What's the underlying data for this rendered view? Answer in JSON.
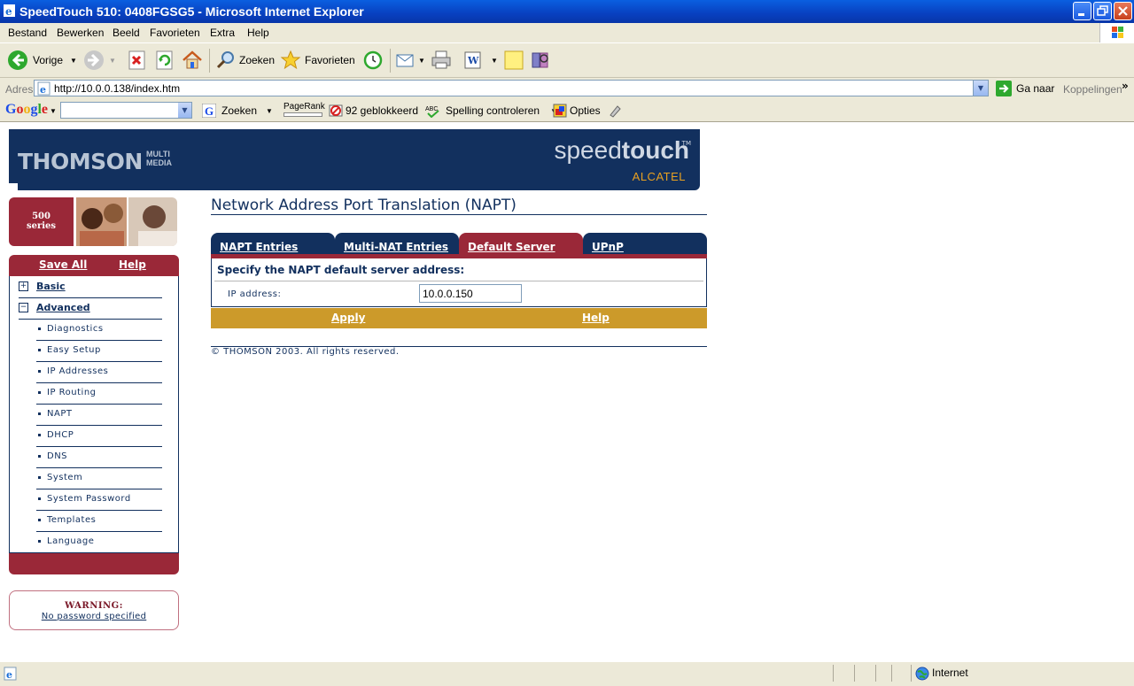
{
  "window": {
    "title": "SpeedTouch 510:  0408FGSG5 - Microsoft Internet Explorer"
  },
  "menu": [
    "Bestand",
    "Bewerken",
    "Beeld",
    "Favorieten",
    "Extra",
    "Help"
  ],
  "toolbar": {
    "back": "Vorige",
    "search": "Zoeken",
    "favorites": "Favorieten"
  },
  "address": {
    "label": "Adres",
    "url": "http://10.0.0.138/index.htm",
    "go": "Ga naar",
    "links": "Koppelingen"
  },
  "google_bar": {
    "logo": "Google",
    "search": "Zoeken",
    "pagerank": "PageRank",
    "blocked": "92 geblokkeerd",
    "spell": "Spelling controleren",
    "options": "Opties"
  },
  "banner": {
    "brand": "THOMSON",
    "brand_sub1": "MULTI",
    "brand_sub2": "MEDIA",
    "product_light": "speed",
    "product_bold": "touch",
    "tm": "TM",
    "maker": "ALCATEL"
  },
  "badge": {
    "line1": "500",
    "line2": "series"
  },
  "sidebar": {
    "save_all": "Save All",
    "help": "Help",
    "basic": "Basic",
    "advanced": "Advanced",
    "items": [
      "Diagnostics",
      "Easy Setup",
      "IP Addresses",
      "IP Routing",
      "NAPT",
      "DHCP",
      "DNS",
      "System",
      "System Password",
      "Templates",
      "Language"
    ]
  },
  "warning": {
    "title": "WARNING:",
    "link": "No password specified"
  },
  "content": {
    "title": "Network Address Port Translation (NAPT)",
    "tabs": [
      "NAPT Entries",
      "Multi-NAT Entries",
      "Default Server",
      "UPnP"
    ],
    "active_tab": "Default Server",
    "heading": "Specify the NAPT default server address:",
    "ip_label": "IP address:",
    "ip_value": "10.0.0.150",
    "apply": "Apply",
    "help": "Help",
    "copyright": "© THOMSON 2003. All rights reserved."
  },
  "status": {
    "zone": "Internet"
  },
  "colors": {
    "navy": "#12305e",
    "maroon": "#9a2838",
    "gold": "#cc9a2a",
    "xp_blue": "#0a5fe0",
    "chrome": "#ece9d8"
  }
}
